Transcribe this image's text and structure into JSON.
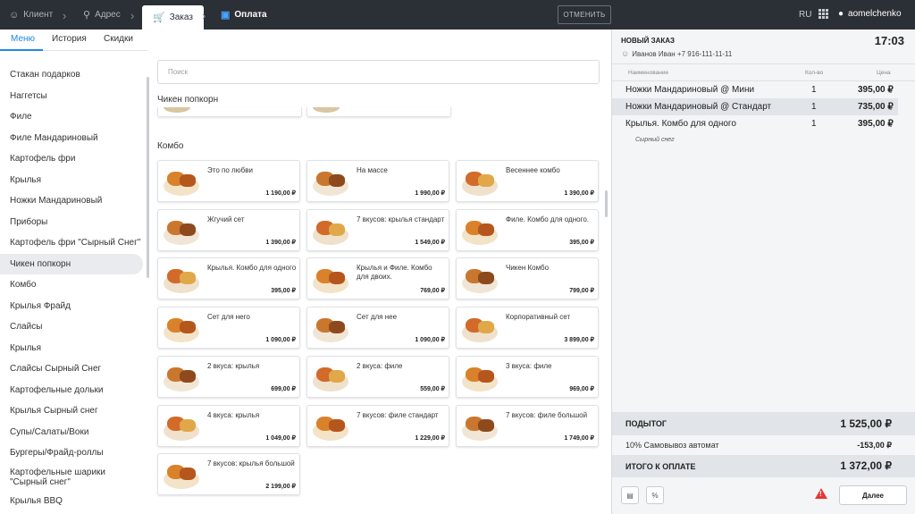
{
  "topbar": {
    "crumbs": [
      {
        "label": "Клиент",
        "icon": "user-icon"
      },
      {
        "label": "Адрес",
        "icon": "pin-icon"
      },
      {
        "label": "Заказ",
        "icon": "cart-icon"
      },
      {
        "label": "Оплата",
        "icon": "calendar-icon"
      }
    ],
    "cancel_label": "ОТМЕНИТЬ",
    "language": "RU",
    "username": "aomelchenko"
  },
  "tabs": [
    "Меню",
    "История",
    "Скидки"
  ],
  "categories": [
    "Стакан подарков",
    "Наггетсы",
    "Филе",
    "Филе Мандариновый",
    "Картофель фри",
    "Крылья",
    "Ножки Мандариновый",
    "Приборы",
    "Картофель фри \"Сырный Снег\"",
    "Чикен попкорн",
    "Комбо",
    "Крылья Фрайд",
    "Слайсы",
    "Крылья",
    "Слайсы Сырный Снег",
    "Картофельные дольки",
    "Крылья Сырный снег",
    "Супы/Салаты/Воки",
    "Бургеры/Фрайд-роллы",
    "Картофельные шарики \"Сырный снег\"",
    "Крылья BBQ"
  ],
  "active_category": "Чикен попкорн",
  "search": {
    "placeholder": "Поиск"
  },
  "groups": {
    "popcorn": "Чикен попкорн",
    "combo": "Комбо"
  },
  "products": [
    {
      "name": "Это по любви",
      "price": "1 190,00 ₽"
    },
    {
      "name": "На массе",
      "price": "1 990,00 ₽"
    },
    {
      "name": "Весеннее комбо",
      "price": "1 390,00 ₽"
    },
    {
      "name": "Жгучий сет",
      "price": "1 390,00 ₽"
    },
    {
      "name": "7 вкусов: крылья стандарт",
      "price": "1 549,00 ₽"
    },
    {
      "name": "Филе. Комбо для одного.",
      "price": "395,00 ₽"
    },
    {
      "name": "Крылья. Комбо для одного",
      "price": "395,00 ₽"
    },
    {
      "name": "Крылья и Филе. Комбо для двоих.",
      "price": "769,00 ₽"
    },
    {
      "name": "Чикен Комбо",
      "price": "799,00 ₽"
    },
    {
      "name": "Сет для него",
      "price": "1 090,00 ₽"
    },
    {
      "name": "Сет для нее",
      "price": "1 090,00 ₽"
    },
    {
      "name": "Корпоративный сет",
      "price": "3 899,00 ₽"
    },
    {
      "name": "2 вкуса: крылья",
      "price": "699,00 ₽"
    },
    {
      "name": "2 вкуса: филе",
      "price": "559,00 ₽"
    },
    {
      "name": "3 вкуса: филе",
      "price": "969,00 ₽"
    },
    {
      "name": "4 вкуса: крылья",
      "price": "1 049,00 ₽"
    },
    {
      "name": "7 вкусов: филе стандарт",
      "price": "1 229,00 ₽"
    },
    {
      "name": "7 вкусов: филе большой",
      "price": "1 749,00 ₽"
    },
    {
      "name": "7 вкусов: крылья большой",
      "price": "2 199,00 ₽"
    }
  ],
  "order": {
    "title": "НОВЫЙ ЗАКАЗ",
    "time": "17:03",
    "client": "Иванов Иван +7 916-111-11-11",
    "columns": {
      "name": "Наименование",
      "qty": "Кол-во",
      "price": "Цена"
    },
    "lines": [
      {
        "name": "Ножки Мандариновый @ Мини",
        "qty": "1",
        "price": "395,00 ₽"
      },
      {
        "name": "Ножки Мандариновый @ Стандарт",
        "qty": "1",
        "price": "735,00 ₽"
      },
      {
        "name": "Крылья. Комбо для одного",
        "qty": "1",
        "price": "395,00 ₽"
      }
    ],
    "modifier": "Сырный снег",
    "subtotal_label": "ПОДЫТОГ",
    "subtotal": "1 525,00 ₽",
    "discount_label": "10% Самовывоз автомат",
    "discount": "-153,00 ₽",
    "total_label": "ИТОГО К ОПЛАТЕ",
    "total": "1 372,00 ₽",
    "next_label": "Далее"
  },
  "colors": {
    "accent": "#1e88e5",
    "topbar": "#2b2f36",
    "warning": "#e53935"
  }
}
